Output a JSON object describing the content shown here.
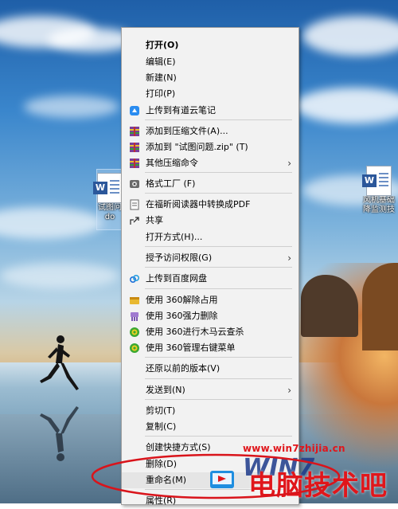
{
  "desktop": {
    "left_file_name": "试图问\ndo",
    "right_file_name": "风机基础\n降监测技"
  },
  "context_menu": {
    "items": [
      {
        "label": "打开(O)",
        "bold": true,
        "icon": ""
      },
      {
        "label": "编辑(E)",
        "icon": ""
      },
      {
        "label": "新建(N)",
        "icon": ""
      },
      {
        "label": "打印(P)",
        "icon": ""
      },
      {
        "label": "上传到有道云笔记",
        "icon": "youdao-note-icon"
      },
      {
        "label": "添加到压缩文件(A)...",
        "icon": "archive-icon"
      },
      {
        "label": "添加到 \"试图问题.zip\" (T)",
        "icon": "archive-icon"
      },
      {
        "label": "其他压缩命令",
        "icon": "archive-icon",
        "submenu": true
      },
      {
        "label": "格式工厂 (F)",
        "icon": "format-factory-icon"
      },
      {
        "label": "在福昕阅读器中转换成PDF",
        "icon": "foxit-pdf-icon"
      },
      {
        "label": "共享",
        "icon": "share-icon"
      },
      {
        "label": "打开方式(H)...",
        "icon": ""
      },
      {
        "label": "授予访问权限(G)",
        "icon": "",
        "submenu": true
      },
      {
        "label": "上传到百度网盘",
        "icon": "baidu-netdisk-icon"
      },
      {
        "label": "使用 360解除占用",
        "icon": "360-unlock-icon"
      },
      {
        "label": "使用 360强力删除",
        "icon": "360-shred-icon"
      },
      {
        "label": "使用 360进行木马云查杀",
        "icon": "360-scan-icon"
      },
      {
        "label": "使用 360管理右键菜单",
        "icon": "360-menu-icon"
      },
      {
        "label": "还原以前的版本(V)",
        "icon": ""
      },
      {
        "label": "发送到(N)",
        "icon": "",
        "submenu": true
      },
      {
        "label": "剪切(T)",
        "icon": ""
      },
      {
        "label": "复制(C)",
        "icon": ""
      },
      {
        "label": "创建快捷方式(S)",
        "icon": ""
      },
      {
        "label": "删除(D)",
        "icon": ""
      },
      {
        "label": "重命名(M)",
        "icon": "",
        "highlighted": true
      },
      {
        "label": "属性(R)",
        "icon": ""
      }
    ]
  },
  "watermark": {
    "url": "www.win7zhijia.cn",
    "title": "电脑技术吧",
    "logo_text": "WIN7"
  },
  "colors": {
    "menu_bg": "#f2f2f2",
    "watermark_red": "#e0161b",
    "annotation_circle": "#d9141b"
  }
}
